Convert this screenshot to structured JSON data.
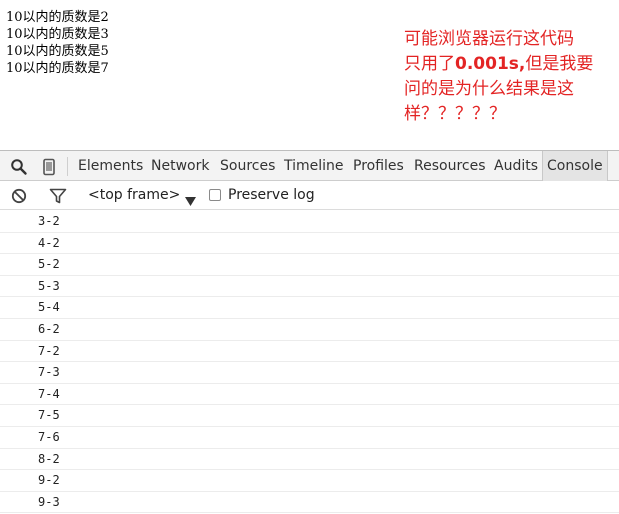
{
  "page": {
    "output_lines": [
      "10以内的质数是2",
      "10以内的质数是3",
      "10以内的质数是5",
      "10以内的质数是7"
    ],
    "note": {
      "line1": "可能浏览器运行这代码",
      "line2_prefix": "只用了",
      "line2_bold": "0.001s,",
      "line2_suffix": "但是我要",
      "line3": "问的是为什么结果是这",
      "line4": "样？？？？？"
    }
  },
  "devtools": {
    "tabs": [
      "Elements",
      "Network",
      "Sources",
      "Timeline",
      "Profiles",
      "Resources",
      "Audits",
      "Console"
    ],
    "active_tab": "Console",
    "icons": [
      "search-icon",
      "device-mode-icon",
      "clear-console-icon",
      "filter-icon",
      "dropdown-arrow-icon"
    ],
    "frame_select": "<top frame>",
    "preserve_log_label": "Preserve log",
    "preserve_log_checked": false,
    "console_messages": [
      "3-2",
      "4-2",
      "5-2",
      "5-3",
      "5-4",
      "6-2",
      "7-2",
      "7-3",
      "7-4",
      "7-5",
      "7-6",
      "8-2",
      "9-2",
      "9-3"
    ]
  },
  "colors": {
    "note_red": "#e32424",
    "toolbar_bg": "#f3f3f3",
    "active_tab_bg": "#e4e4e4"
  }
}
